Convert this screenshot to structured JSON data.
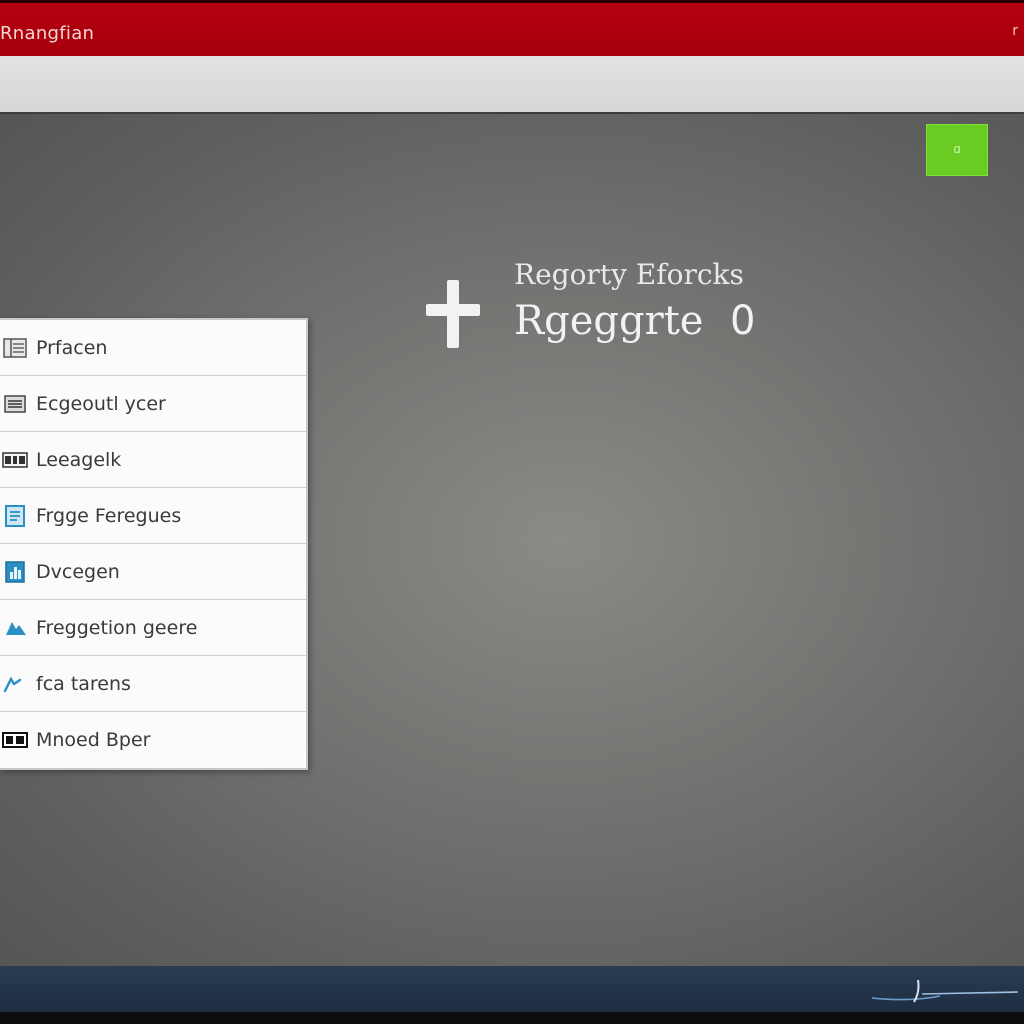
{
  "window": {
    "title": "Rnangfian",
    "titlebar_mark": "r"
  },
  "corner_button": {
    "label": "ɑ",
    "color": "#6acc23"
  },
  "hero": {
    "subtitle": "Regorty Eforcks",
    "title": "Rgeggrte",
    "count": "0"
  },
  "menu": {
    "items": [
      {
        "label": "Prfacen",
        "icon": "grid-doc-icon"
      },
      {
        "label": "Ecgeoutl ycer",
        "icon": "list-icon"
      },
      {
        "label": "Leeagelk",
        "icon": "code-box-icon"
      },
      {
        "label": "Frgge Feregues",
        "icon": "document-icon"
      },
      {
        "label": "Dvcegen",
        "icon": "chart-doc-icon"
      },
      {
        "label": "Freggetion geere",
        "icon": "cloud-icon"
      },
      {
        "label": "fca tarens",
        "icon": "pen-icon"
      },
      {
        "label": "Mnoed Bper",
        "icon": "keyboard-icon"
      }
    ]
  },
  "colors": {
    "titlebar": "#b5000e",
    "accent_green": "#6acc23",
    "icon_blue": "#2a8fc4",
    "taskbar": "#243549"
  }
}
